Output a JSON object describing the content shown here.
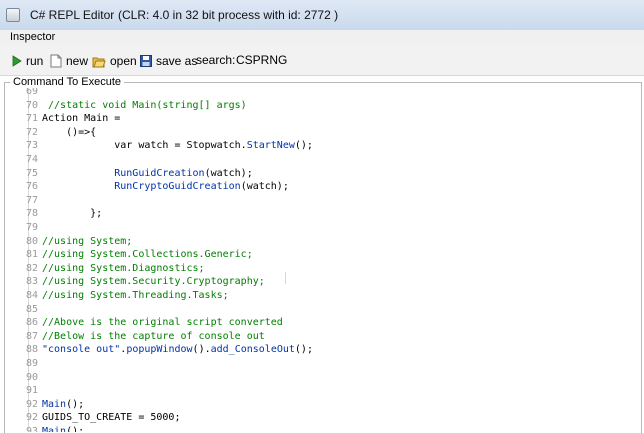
{
  "window": {
    "title": "C# REPL Editor",
    "subtitle": "(CLR: 4.0 in 32 bit process with id: 2772 )"
  },
  "inspector": {
    "title": "Inspector"
  },
  "toolbar": {
    "run_label": "run",
    "new_label": "new",
    "open_label": "open",
    "save_as_label": "save as",
    "search_label": "search:",
    "search_value": "CSPRNG"
  },
  "command_panel": {
    "title": "Command To Execute"
  },
  "colors": {
    "comment": "#007f00",
    "method": "#0033aa",
    "line_number": "#9a9a9a"
  },
  "editor": {
    "lines": [
      {
        "num": "69",
        "segments": [
          {
            "t": "",
            "c": "code"
          }
        ]
      },
      {
        "num": "70",
        "segments": [
          {
            "t": " //static void Main(string[] args)",
            "c": "c-comment"
          }
        ]
      },
      {
        "num": "71",
        "segments": [
          {
            "t": "Action Main =",
            "c": "code"
          }
        ]
      },
      {
        "num": "72",
        "segments": [
          {
            "t": "    ()=>{",
            "c": "code"
          }
        ]
      },
      {
        "num": "73",
        "segments": [
          {
            "t": "            var watch = Stopwatch.",
            "c": "code"
          },
          {
            "t": "StartNew",
            "c": "c-method"
          },
          {
            "t": "();",
            "c": "code"
          }
        ]
      },
      {
        "num": "74",
        "segments": [
          {
            "t": "",
            "c": "code"
          }
        ]
      },
      {
        "num": "75",
        "segments": [
          {
            "t": "            ",
            "c": "code"
          },
          {
            "t": "RunGuidCreation",
            "c": "c-method"
          },
          {
            "t": "(watch);",
            "c": "code"
          }
        ]
      },
      {
        "num": "76",
        "segments": [
          {
            "t": "            ",
            "c": "code"
          },
          {
            "t": "RunCryptoGuidCreation",
            "c": "c-method"
          },
          {
            "t": "(watch);",
            "c": "code"
          }
        ]
      },
      {
        "num": "77",
        "segments": [
          {
            "t": "",
            "c": "code"
          }
        ]
      },
      {
        "num": "78",
        "segments": [
          {
            "t": "        };",
            "c": "code"
          }
        ]
      },
      {
        "num": "79",
        "segments": [
          {
            "t": "",
            "c": "code"
          }
        ]
      },
      {
        "num": "80",
        "segments": [
          {
            "t": "//using System;",
            "c": "c-comment"
          }
        ]
      },
      {
        "num": "81",
        "segments": [
          {
            "t": "//using System.Collections.Generic;",
            "c": "c-comment"
          }
        ]
      },
      {
        "num": "82",
        "segments": [
          {
            "t": "//using System.Diagnostics;",
            "c": "c-comment"
          }
        ]
      },
      {
        "num": "83",
        "segments": [
          {
            "t": "//using System.Security.Cryptography;",
            "c": "c-comment"
          }
        ]
      },
      {
        "num": "84",
        "segments": [
          {
            "t": "//using System.Threading.Tasks;",
            "c": "c-comment"
          }
        ]
      },
      {
        "num": "85",
        "segments": [
          {
            "t": "",
            "c": "code"
          }
        ]
      },
      {
        "num": "86",
        "segments": [
          {
            "t": "//Above is the original script converted",
            "c": "c-comment"
          }
        ]
      },
      {
        "num": "87",
        "segments": [
          {
            "t": "//Below is the capture of console out",
            "c": "c-comment"
          }
        ]
      },
      {
        "num": "88",
        "segments": [
          {
            "t": "\"console out\"",
            "c": "c-string"
          },
          {
            "t": ".",
            "c": "code"
          },
          {
            "t": "popupWindow",
            "c": "c-method"
          },
          {
            "t": "().",
            "c": "code"
          },
          {
            "t": "add_ConsoleOut",
            "c": "c-method"
          },
          {
            "t": "();",
            "c": "code"
          }
        ]
      },
      {
        "num": "89",
        "segments": [
          {
            "t": "",
            "c": "code"
          }
        ]
      },
      {
        "num": "90",
        "segments": [
          {
            "t": "",
            "c": "code"
          }
        ]
      },
      {
        "num": "91",
        "segments": [
          {
            "t": "",
            "c": "code"
          }
        ]
      },
      {
        "num": "92",
        "segments": [
          {
            "t": "Main",
            "c": "c-method"
          },
          {
            "t": "();",
            "c": "code"
          }
        ]
      },
      {
        "num": "92",
        "segments": [
          {
            "t": "GUIDS_TO_CREATE = 5000;",
            "c": "code"
          }
        ]
      },
      {
        "num": "93",
        "segments": [
          {
            "t": "Main",
            "c": "c-method"
          },
          {
            "t": "();",
            "c": "code"
          }
        ]
      }
    ]
  }
}
